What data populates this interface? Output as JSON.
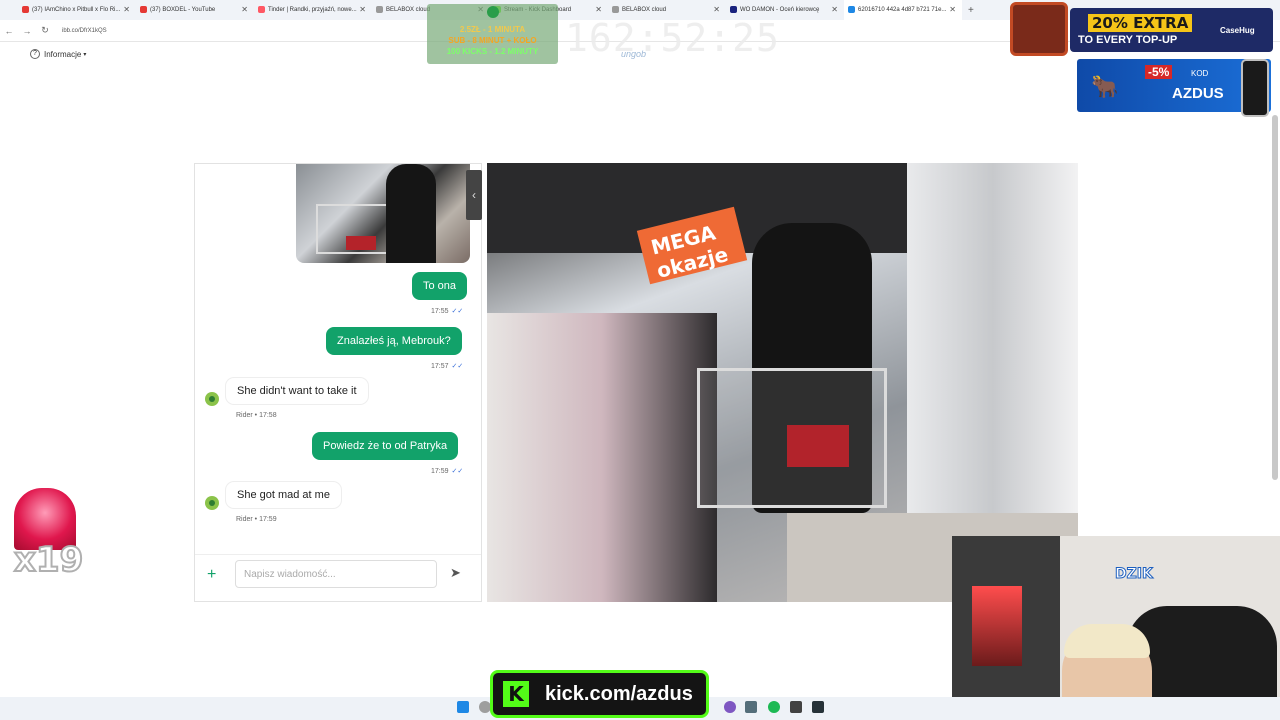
{
  "browser": {
    "tabs": [
      {
        "label": "(37) IAmChino x Pitbull x Flo Ri...",
        "color": "#e53935"
      },
      {
        "label": "(37) BOXDEL - YouTube",
        "color": "#e53935"
      },
      {
        "label": "Tinder | Randki, przyjaźń, nowe...",
        "color": "#ff5864"
      },
      {
        "label": "BELABOX cloud",
        "color": "#999999"
      },
      {
        "label": "Stream - Kick Dashboard",
        "color": "#53fc18"
      },
      {
        "label": "BELABOX cloud",
        "color": "#999999"
      },
      {
        "label": "WO DAMON - Oceń kierowcę",
        "color": "#1a237e"
      },
      {
        "label": "62016710 442a 4d87 b721 71e...",
        "color": "#1e88e5"
      }
    ],
    "url": "ibb.co/DfrX1kQS",
    "info_label": "Informacje"
  },
  "chat": {
    "messages": [
      {
        "dir": "out",
        "text": "To ona",
        "time": "17:55"
      },
      {
        "dir": "out",
        "text": "Znalazłeś ją, Mebrouk?",
        "time": "17:57"
      },
      {
        "dir": "in",
        "text": "She didn't want to take it",
        "meta": "Rider • 17:58"
      },
      {
        "dir": "out",
        "text": "Powiedz że to od Patryka",
        "time": "17:59"
      },
      {
        "dir": "in",
        "text": "She got mad at me",
        "meta": "Rider • 17:59"
      }
    ],
    "input_placeholder": "Napisz wiadomość..."
  },
  "photo": {
    "sign_text": "MEGA okazje"
  },
  "overlay": {
    "timer": "162:52:25",
    "timer_sub": "ungob",
    "goals": [
      "2.5ZŁ - 1 MINUTA",
      "SUB - 8 MINUT + KOŁO",
      "100 KICKS - 1.2 MINUTY"
    ],
    "promo_top": {
      "highlight": "20% EXTRA",
      "sub": "TO EVERY TOP-UP",
      "brand": "CaseHug"
    },
    "promo_code": {
      "discount": "-5%",
      "label": "KOD",
      "code": "AZDUS"
    },
    "alert_count": "x19",
    "webcam_logo": "DZIK",
    "kick_label": "kick.com/azdus"
  },
  "colors": {
    "accent_green": "#12a26a",
    "kick_green": "#53fc18"
  }
}
